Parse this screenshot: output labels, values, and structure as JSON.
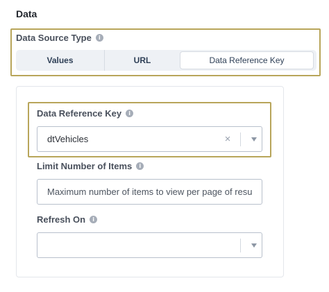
{
  "section": {
    "title": "Data"
  },
  "data_source_type": {
    "label": "Data Source Type",
    "options": [
      "Values",
      "URL",
      "Data Reference Key"
    ],
    "selected": "Data Reference Key"
  },
  "data_reference_key": {
    "label": "Data Reference Key",
    "value": "dtVehicles",
    "clear_glyph": "×"
  },
  "limit_items": {
    "label": "Limit Number of Items",
    "placeholder": "Maximum number of items to view per page of resul"
  },
  "refresh_on": {
    "label": "Refresh On",
    "value": ""
  },
  "icons": {
    "info": "info-icon",
    "dropdown": "chevron-down-icon",
    "clear": "close-icon"
  },
  "colors": {
    "highlight": "#b8a55a",
    "segment_bg": "#eef1f5",
    "text": "#2b2f36"
  }
}
